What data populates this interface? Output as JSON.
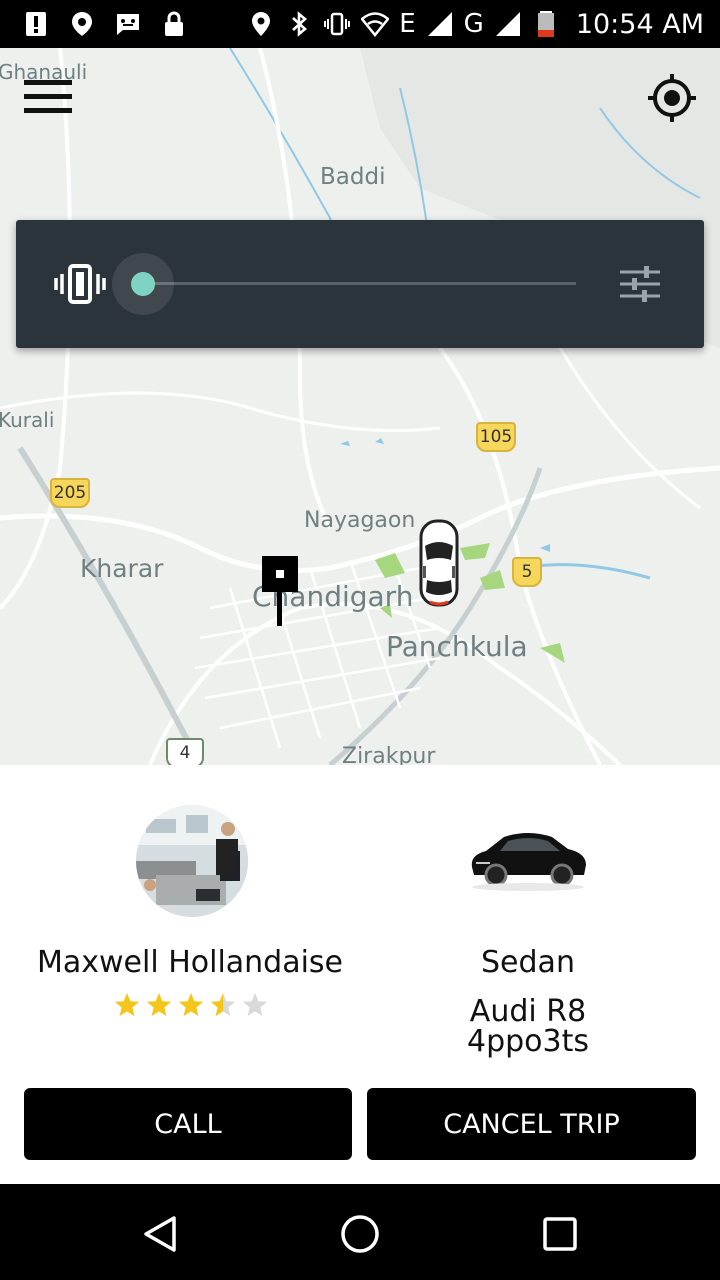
{
  "status_bar": {
    "time": "10:54 AM",
    "network_e": "E",
    "network_g": "G",
    "icons": [
      "alert-icon",
      "location-pin-icon",
      "message-icon",
      "lock-icon",
      "location-icon",
      "bluetooth-icon",
      "vibrate-icon",
      "wifi-icon",
      "signal-icon",
      "battery-icon"
    ]
  },
  "map": {
    "labels": {
      "ghanauli": "Ghanauli",
      "baddi": "Baddi",
      "kurali": "Kurali",
      "nayagaon": "Nayagaon",
      "kharar": "Kharar",
      "chandigarh": "Chandigarh",
      "panchkula": "Panchkula",
      "zirakpur": "Zirakpur"
    },
    "shields": {
      "nh105": "105",
      "nh205": "205",
      "nh5": "5",
      "nh4": "4"
    }
  },
  "volume": {
    "level": 0.0,
    "icons": [
      "vibrate-icon",
      "sliders-icon"
    ]
  },
  "trip": {
    "driver_name": "Maxwell Hollandaise",
    "rating": 3.5,
    "rating_max": 5,
    "car_type": "Sedan",
    "car_model": "Audi R8",
    "plate": "4ppo3ts",
    "call_label": "CALL",
    "cancel_label": "CANCEL TRIP"
  },
  "nav": {
    "icons": [
      "back-icon",
      "home-icon",
      "recents-icon"
    ]
  },
  "colors": {
    "accent": "#7fd3c4",
    "panel": "#2b333b",
    "star_filled": "#f5c518",
    "star_empty": "#d9d9d9",
    "button": "#000000"
  }
}
